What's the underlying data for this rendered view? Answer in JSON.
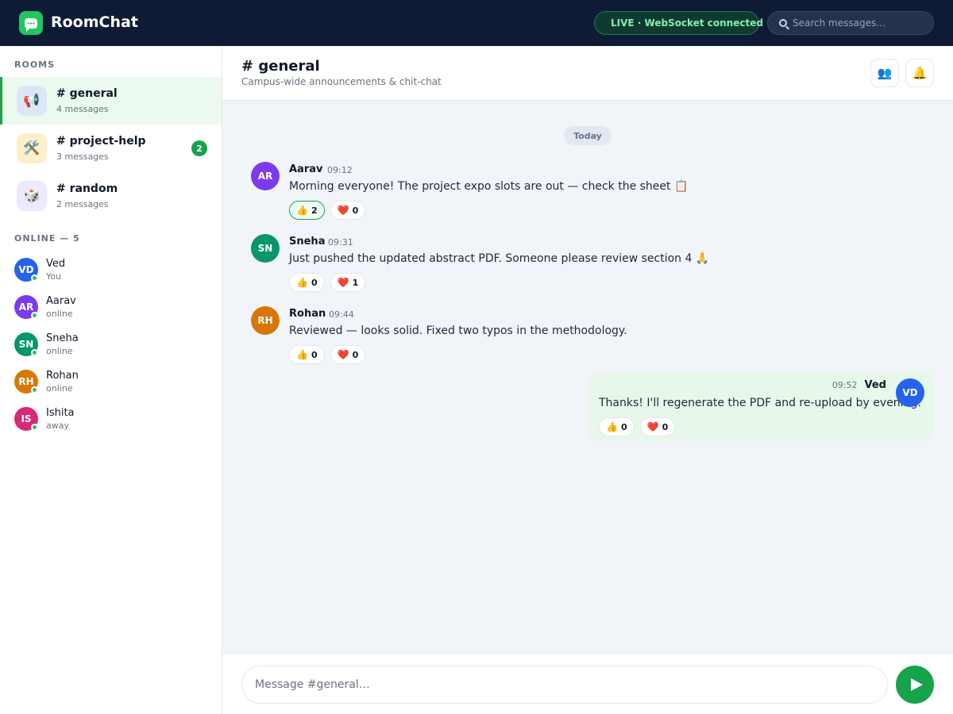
{
  "app": {
    "title": "RoomChat"
  },
  "topbar": {
    "live_status": "LIVE · WebSocket connected",
    "search_placeholder": "Search messages…"
  },
  "sidebar": {
    "rooms_label": "ROOMS",
    "rooms": [
      {
        "name": "# general",
        "count": "4 messages",
        "icon": "megaphone-icon",
        "emoji": "📢",
        "active": true,
        "unread": ""
      },
      {
        "name": "# project-help",
        "count": "3 messages",
        "icon": "tools-icon",
        "emoji": "🛠️",
        "active": false,
        "unread": "2"
      },
      {
        "name": "# random",
        "count": "2 messages",
        "icon": "dice-icon",
        "emoji": "🎲",
        "active": false,
        "unread": ""
      }
    ],
    "online_label": "ONLINE — 5",
    "users": [
      {
        "initials": "VD",
        "name": "Ved",
        "status": "You",
        "color": "#2563eb"
      },
      {
        "initials": "AR",
        "name": "Aarav",
        "status": "online",
        "color": "#7c3aed"
      },
      {
        "initials": "SN",
        "name": "Sneha",
        "status": "online",
        "color": "#059669"
      },
      {
        "initials": "RH",
        "name": "Rohan",
        "status": "online",
        "color": "#d97706"
      },
      {
        "initials": "IS",
        "name": "Ishita",
        "status": "away",
        "color": "#db2777"
      }
    ]
  },
  "header": {
    "channel": "# general",
    "description": "Campus-wide announcements & chit-chat",
    "members_icon": "members-icon",
    "bell_icon": "bell-icon"
  },
  "chat": {
    "day_divider": "Today",
    "messages": [
      {
        "initials": "AR",
        "author": "Aarav",
        "time": "09:12",
        "text": "Morning everyone! The project expo slots are out — check the sheet 📋",
        "color": "#7c3aed",
        "likes": "2",
        "hearts": "0",
        "liked": true
      },
      {
        "initials": "SN",
        "author": "Sneha",
        "time": "09:31",
        "text": "Just pushed the updated abstract PDF. Someone please review section 4 🙏",
        "color": "#059669",
        "likes": "0",
        "hearts": "1",
        "liked": false
      },
      {
        "initials": "RH",
        "author": "Rohan",
        "time": "09:44",
        "text": "Reviewed — looks solid. Fixed two typos in the methodology.",
        "color": "#d97706",
        "likes": "0",
        "hearts": "0",
        "liked": false
      }
    ],
    "own_message": {
      "initials": "VD",
      "author": "Ved",
      "time": "09:52",
      "text": "Thanks! I'll regenerate the PDF and re-upload by evening.",
      "color": "#2563eb",
      "likes": "0",
      "hearts": "0"
    }
  },
  "composer": {
    "placeholder": "Message #general…"
  },
  "colors": {
    "accent": "#16a34a",
    "topbar": "#0f1b35",
    "own_bubble": "#e7f7ea"
  }
}
